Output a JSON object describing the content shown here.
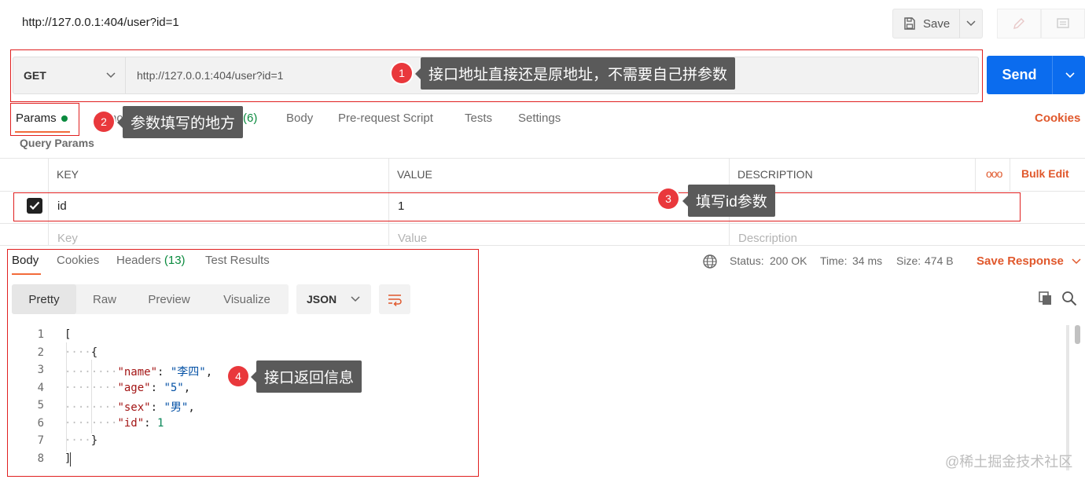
{
  "title_url": "http://127.0.0.1:404/user?id=1",
  "save": {
    "label": "Save"
  },
  "request": {
    "method": "GET",
    "url": "http://127.0.0.1:404/user?id=1",
    "send_label": "Send"
  },
  "tabs": {
    "params": "Params",
    "headers_partial": "hor",
    "headers_count": "(6)",
    "body": "Body",
    "pre_request": "Pre-request Script",
    "tests": "Tests",
    "settings": "Settings",
    "cookies": "Cookies"
  },
  "query_params": {
    "title": "Query Params",
    "columns": {
      "key": "KEY",
      "value": "VALUE",
      "description": "DESCRIPTION"
    },
    "more": "ooo",
    "bulk_edit": "Bulk Edit",
    "row": {
      "key": "id",
      "value": "1",
      "checked": true
    },
    "placeholders": {
      "key": "Key",
      "value": "Value",
      "description": "Description"
    }
  },
  "response": {
    "tabs": {
      "body": "Body",
      "cookies": "Cookies",
      "headers": "Headers",
      "headers_count": "(13)",
      "test_results": "Test Results"
    },
    "status_label": "Status:",
    "status_value": "200 OK",
    "time_label": "Time:",
    "time_value": "34 ms",
    "size_label": "Size:",
    "size_value": "474 B",
    "save_response": "Save Response",
    "view_modes": {
      "pretty": "Pretty",
      "raw": "Raw",
      "preview": "Preview",
      "visualize": "Visualize"
    },
    "format": "JSON",
    "line_numbers": [
      "1",
      "2",
      "3",
      "4",
      "5",
      "6",
      "7",
      "8"
    ],
    "code": {
      "l1": "[",
      "l2": "{",
      "name_key": "\"name\"",
      "name_val": "\"李四\"",
      "age_key": "\"age\"",
      "age_val": "\"5\"",
      "sex_key": "\"sex\"",
      "sex_val": "\"男\"",
      "id_key": "\"id\"",
      "id_val": "1",
      "l7": "}",
      "l8": "]"
    }
  },
  "annotations": {
    "n1": "1",
    "t1": "接口地址直接还是原地址，不需要自己拼参数",
    "n2": "2",
    "t2": "参数填写的地方",
    "n3": "3",
    "t3": "填写id参数",
    "n4": "4",
    "t4": "接口返回信息"
  },
  "watermark": "@稀土掘金技术社区",
  "colors": {
    "accent": "#f26b3a",
    "send": "#0b6cee",
    "status_green": "#0a8a3e",
    "annotation_red": "#e02020"
  }
}
